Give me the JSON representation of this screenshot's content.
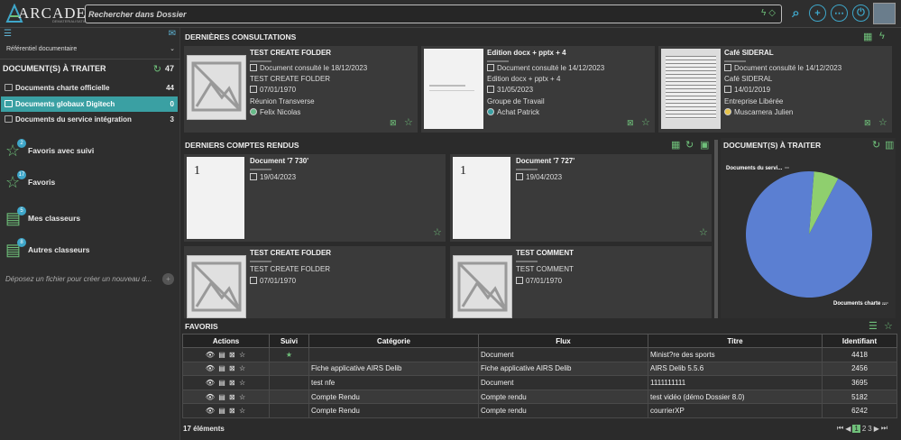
{
  "app": {
    "logo_text": "ARCADE",
    "logo_sub": "DEMATERIALISATION",
    "search_placeholder": "Rechercher dans Dossier"
  },
  "sidebar": {
    "referentiel": "Référentiel documentaire",
    "section_title": "DOCUMENT(S) À TRAITER",
    "section_count": "47",
    "folders": [
      {
        "label": "Documents charte officielle",
        "count": "44"
      },
      {
        "label": "Documents globaux Digitech",
        "count": "0"
      },
      {
        "label": "Documents du service intégration",
        "count": "3"
      }
    ],
    "nav": [
      {
        "label": "Favoris avec suivi",
        "badge": "2"
      },
      {
        "label": "Favoris",
        "badge": "17"
      },
      {
        "label": "Mes classeurs",
        "badge": "5"
      },
      {
        "label": "Autres classeurs",
        "badge": "8"
      }
    ],
    "drop_hint": "Déposez un fichier pour créer un nouveau d..."
  },
  "consultations": {
    "title": "DERNIÈRES CONSULTATIONS",
    "cards": [
      {
        "title": "TEST CREATE FOLDER",
        "line1": "Document consulté le 18/12/2023",
        "line2": "TEST CREATE FOLDER",
        "date": "07/01/1970",
        "line3": "Réunion Transverse",
        "person": "Felix Nicolas"
      },
      {
        "title": "Edition docx + pptx + 4",
        "line1": "Document consulté le 14/12/2023",
        "line2": "Edition docx + pptx + 4",
        "date": "31/05/2023",
        "line3": "Groupe de Travail",
        "person": "Achat Patrick"
      },
      {
        "title": "Café SIDERAL",
        "line1": "Document consulté le 14/12/2023",
        "line2": "Café SIDERAL",
        "date": "14/01/2019",
        "line3": "Entreprise Libérée",
        "person": "Muscarnera Julien"
      }
    ]
  },
  "comptes": {
    "title": "DERNIERS COMPTES RENDUS",
    "cards": [
      {
        "title": "Document '7 730'",
        "date": "19/04/2023",
        "thumb_num": "1"
      },
      {
        "title": "Document '7 727'",
        "date": "19/04/2023",
        "thumb_num": "1"
      },
      {
        "title": "TEST CREATE FOLDER",
        "sub": "TEST CREATE FOLDER",
        "date": "07/01/1970"
      },
      {
        "title": "TEST COMMENT",
        "sub": "TEST COMMENT",
        "date": "07/01/1970"
      }
    ]
  },
  "pie": {
    "title": "DOCUMENT(S) À TRAITER",
    "colors": {
      "major": "#5b7fd2",
      "minor": "#8fcf6e"
    },
    "chart_data": {
      "type": "pie",
      "slices": [
        {
          "label": "Documents charte ...",
          "value": 44
        },
        {
          "label": "Documents du servi...",
          "value": 3
        }
      ]
    }
  },
  "favoris": {
    "title": "FAVORIS",
    "headers": [
      "Actions",
      "Suivi",
      "Catégorie",
      "Flux",
      "Titre",
      "Identifiant"
    ],
    "rows": [
      {
        "categorie": "",
        "flux": "Document",
        "titre": "Minist?re des sports",
        "id": "4418",
        "suivi": "★"
      },
      {
        "categorie": "Fiche applicative AIRS Delib",
        "flux": "Fiche applicative AIRS Delib",
        "titre": "AIRS Delib 5.5.6",
        "id": "2456",
        "suivi": ""
      },
      {
        "categorie": "test nfe",
        "flux": "Document",
        "titre": "1111111111",
        "id": "3695",
        "suivi": ""
      },
      {
        "categorie": "Compte Rendu",
        "flux": "Compte rendu",
        "titre": "test vidéo (démo Dossier 8.0)",
        "id": "5182",
        "suivi": ""
      },
      {
        "categorie": "Compte Rendu",
        "flux": "Compte rendu",
        "titre": "courrierXP",
        "id": "6242",
        "suivi": ""
      }
    ],
    "count_label": "17 éléments",
    "pages": [
      "1",
      "2",
      "3"
    ]
  }
}
